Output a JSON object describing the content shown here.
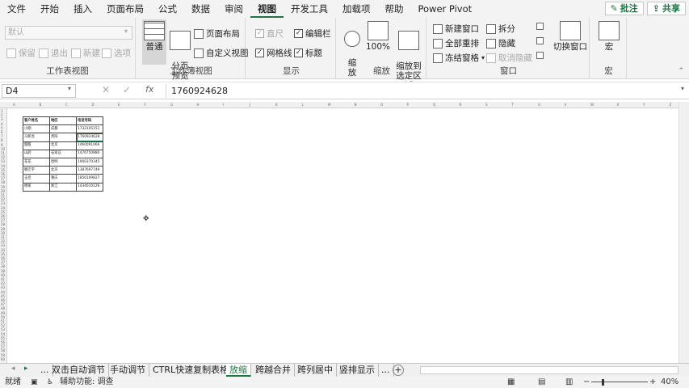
{
  "menu": {
    "tabs": [
      "文件",
      "开始",
      "插入",
      "页面布局",
      "公式",
      "数据",
      "审阅",
      "视图",
      "开发工具",
      "加载项",
      "帮助",
      "Power Pivot"
    ],
    "active_tab": "视图",
    "comment_label": "批注",
    "share_label": "共享"
  },
  "ribbon": {
    "sheet_view": {
      "select_value": "默认",
      "keep": "保留",
      "exit": "退出",
      "new": "新建",
      "options": "选项",
      "label": "工作表视图"
    },
    "workbook_views": {
      "normal": "普通",
      "page_break": "分页\n预览",
      "page_layout": "页面布局",
      "custom": "自定义视图",
      "label": "工作簿视图"
    },
    "show": {
      "ruler": "直尺",
      "formula_bar": "编辑栏",
      "gridlines": "网格线",
      "headings": "标题",
      "label": "显示"
    },
    "zoom": {
      "zoom": "缩\n放",
      "hundred": "100%",
      "to_selection": "缩放到\n选定区域",
      "label": "缩放"
    },
    "window": {
      "new_window": "新建窗口",
      "arrange_all": "全部重排",
      "freeze": "冻结窗格",
      "split": "拆分",
      "hide": "隐藏",
      "unhide": "取消隐藏",
      "switch": "切换窗口",
      "label": "窗口"
    },
    "macros": {
      "macro": "宏",
      "label": "宏"
    }
  },
  "formula_bar": {
    "name_box": "D4",
    "fx": "fx",
    "value": "1760924628"
  },
  "columns": [
    "A",
    "B",
    "C",
    "D",
    "E",
    "F",
    "G",
    "H",
    "I",
    "J",
    "K",
    "L",
    "M",
    "N",
    "O",
    "P",
    "Q",
    "R",
    "S",
    "T",
    "U",
    "V",
    "W",
    "X",
    "Y",
    "Z",
    "AA",
    "AB",
    "AC"
  ],
  "table": {
    "headers": [
      "客户姓名",
      "地区",
      "电话号码"
    ],
    "rows": [
      [
        "小刚",
        "成都",
        "1732105151"
      ],
      [
        "马新亮",
        "贵阳",
        "1760924628"
      ],
      [
        "甜甜",
        "北京",
        "1460091066"
      ],
      [
        "山药",
        "石家庄",
        "1476750880"
      ],
      [
        "花花",
        "昆明",
        "1900370345"
      ],
      [
        "嘟迁宇",
        "北京",
        "1387697749"
      ],
      [
        "玉佳",
        "重庆",
        "1856109827"
      ],
      [
        "德家",
        "浙江",
        "1434010126"
      ]
    ]
  },
  "sheets": {
    "more_left": "...",
    "tabs": [
      "双击自动调节",
      "手动调节",
      "CTRL快速复制表格",
      "放缩",
      "跨越合并",
      "跨列居中",
      "竖排显示"
    ],
    "active": "放缩",
    "more_right": "...",
    "add": "+"
  },
  "status": {
    "ready": "就绪",
    "accessibility": "辅助功能: 调查",
    "zoom": "40%",
    "zoom_level": 0.4
  },
  "colors": {
    "accent": "#217346"
  }
}
